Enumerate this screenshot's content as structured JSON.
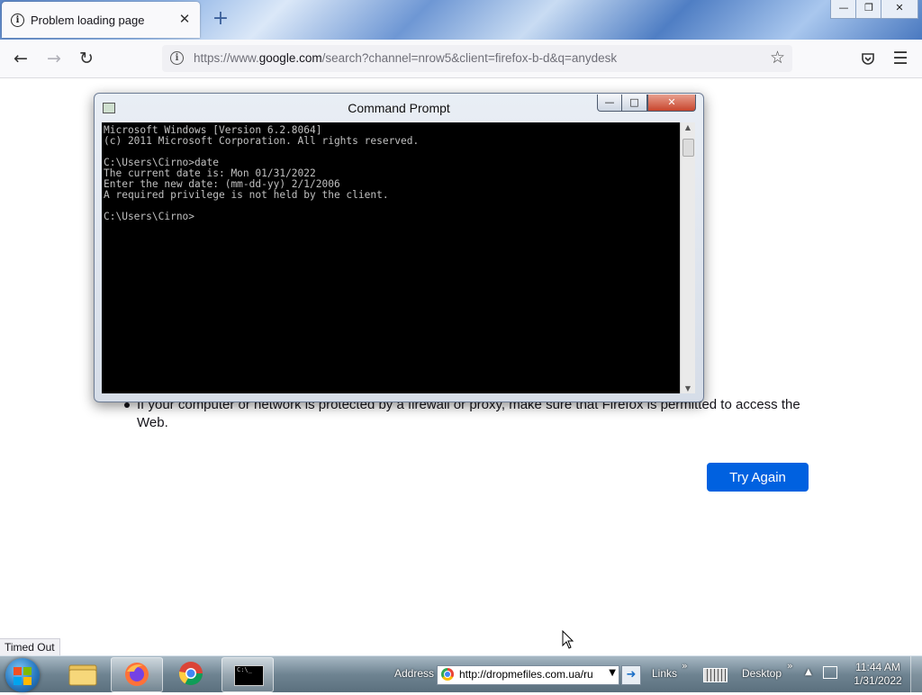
{
  "browser": {
    "tab_title": "Problem loading page",
    "tab_close": "✕",
    "new_tab": "+",
    "url_host_prefix": "https://www.",
    "url_host": "google.com",
    "url_path": "/search?channel=nrow5&client=firefox-b-d&q=anydesk"
  },
  "page": {
    "bullet": "If your computer or network is protected by a firewall or proxy, make sure that Firefox is permitted to access the Web.",
    "try_again": "Try Again",
    "status": "Timed Out"
  },
  "cmd": {
    "title": "Command Prompt",
    "lines": [
      "Microsoft Windows [Version 6.2.8064]",
      "(c) 2011 Microsoft Corporation. All rights reserved.",
      "",
      "C:\\Users\\Cirno>date",
      "The current date is: Mon 01/31/2022",
      "Enter the new date: (mm-dd-yy) 2/1/2006",
      "A required privilege is not held by the client.",
      "",
      "C:\\Users\\Cirno>"
    ]
  },
  "taskbar": {
    "address_label": "Address",
    "address_value": "http://dropmefiles.com.ua/ru",
    "links_label": "Links",
    "desktop_label": "Desktop",
    "time": "11:44 AM",
    "date": "1/31/2022"
  }
}
